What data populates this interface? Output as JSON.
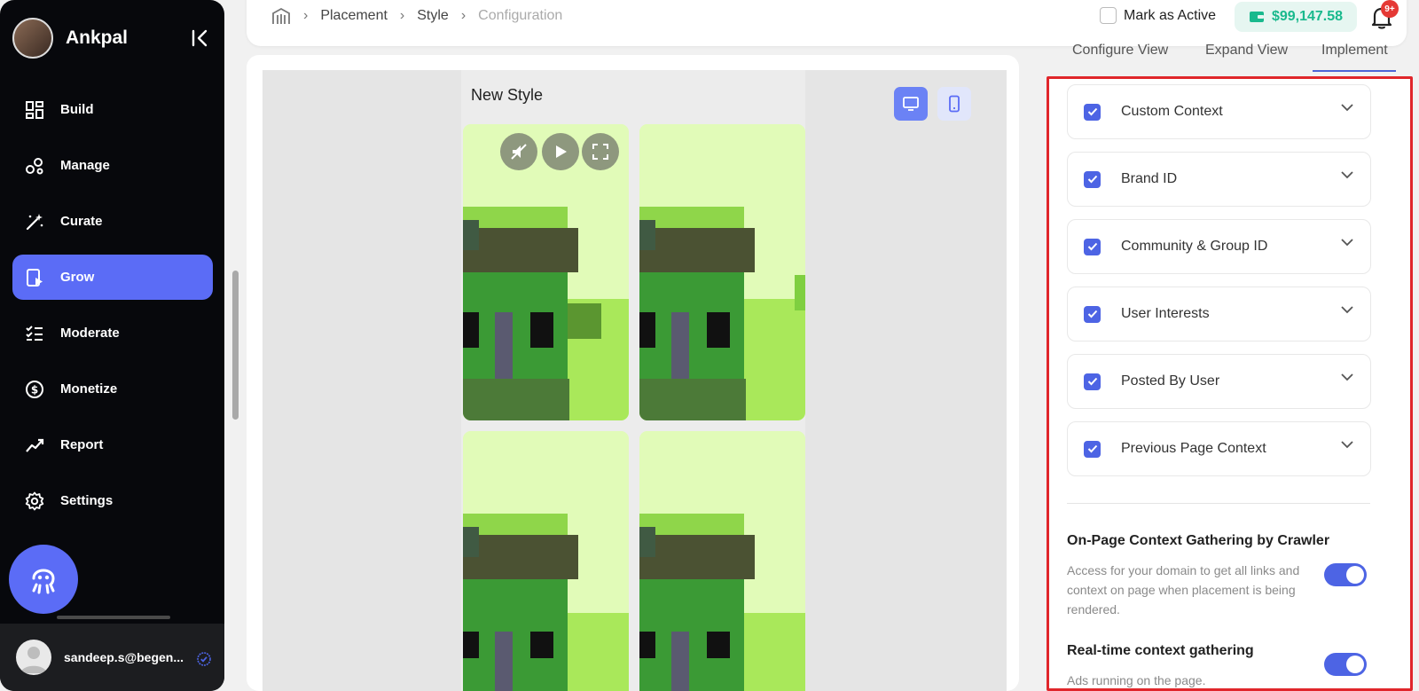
{
  "sidebar": {
    "brand_name": "Ankpal",
    "nav_items": [
      {
        "label": "Build",
        "icon": "grid-icon"
      },
      {
        "label": "Manage",
        "icon": "nodes-icon"
      },
      {
        "label": "Curate",
        "icon": "magic-wand-icon"
      },
      {
        "label": "Grow",
        "icon": "mobile-play-icon",
        "active": true
      },
      {
        "label": "Moderate",
        "icon": "checklist-icon"
      },
      {
        "label": "Monetize",
        "icon": "dollar-circle-icon"
      },
      {
        "label": "Report",
        "icon": "trend-icon"
      },
      {
        "label": "Settings",
        "icon": "gear-icon"
      }
    ],
    "user_email": "sandeep.s@begen..."
  },
  "header": {
    "breadcrumbs": [
      "Placement",
      "Style",
      "Configuration"
    ],
    "mark_active_label": "Mark as Active",
    "wallet_balance": "$99,147.58",
    "notification_badge": "9+"
  },
  "preview": {
    "title": "New Style"
  },
  "right_panel": {
    "tabs": [
      "Configure View",
      "Expand View",
      "Implement"
    ],
    "active_tab": "Implement",
    "context_items": [
      {
        "label": "Custom Context",
        "checked": true
      },
      {
        "label": "Brand ID",
        "checked": true
      },
      {
        "label": "Community & Group ID",
        "checked": true
      },
      {
        "label": "User Interests",
        "checked": true
      },
      {
        "label": "Posted By User",
        "checked": true
      },
      {
        "label": "Previous Page Context",
        "checked": true
      }
    ],
    "crawler": {
      "title": "On-Page Context Gathering by Crawler",
      "description": "Access for your domain to get all links and context on page when placement is being rendered.",
      "enabled": true
    },
    "realtime": {
      "title": "Real-time context gathering",
      "description": "Ads running on the page.",
      "enabled": true
    }
  },
  "colors": {
    "accent": "#5b6cf6",
    "highlight_border": "#e0262b",
    "wallet_text": "#19b98d"
  }
}
